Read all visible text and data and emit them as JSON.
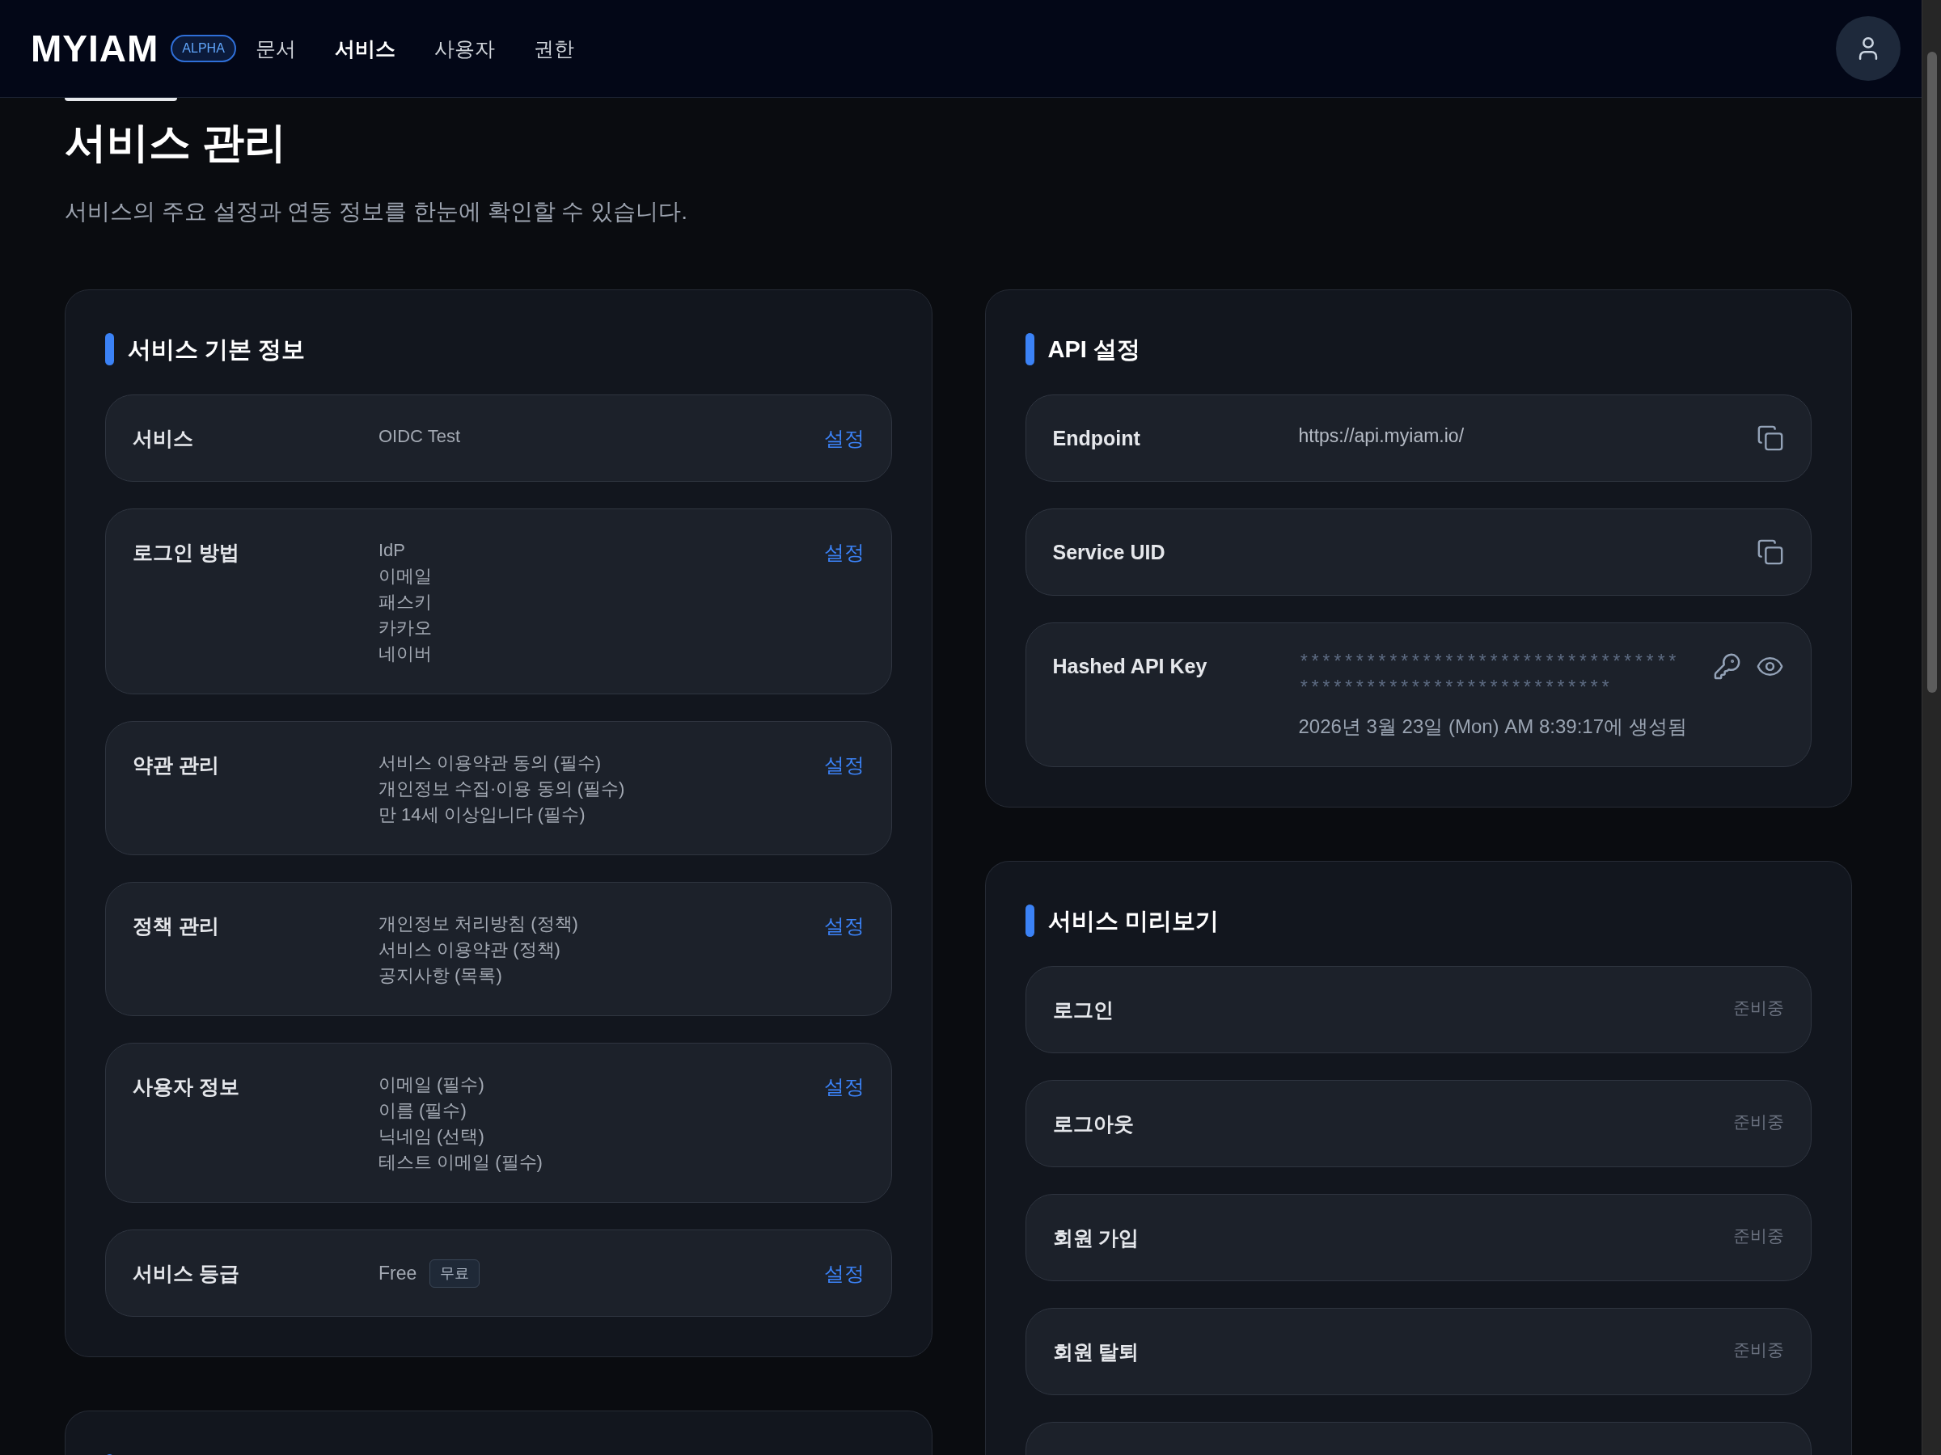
{
  "header": {
    "logo": "MYIAM",
    "badge": "ALPHA",
    "nav": [
      {
        "label": "문서",
        "selected": false
      },
      {
        "label": "서비스",
        "selected": true
      },
      {
        "label": "사용자",
        "selected": false
      },
      {
        "label": "권한",
        "selected": false
      }
    ]
  },
  "page": {
    "title": "서비스 관리",
    "subtitle": "서비스의 주요 설정과 연동 정보를 한눈에 확인할 수 있습니다."
  },
  "basic_info": {
    "title": "서비스 기본 정보",
    "rows": [
      {
        "kind": "lines",
        "label": "서비스",
        "values": [
          "OIDC Test"
        ],
        "action": "설정"
      },
      {
        "kind": "lines",
        "label": "로그인 방법",
        "values": [
          "IdP",
          "이메일",
          "패스키",
          "카카오",
          "네이버"
        ],
        "action": "설정"
      },
      {
        "kind": "lines",
        "label": "약관 관리",
        "values": [
          "서비스 이용약관 동의 (필수)",
          "개인정보 수집·이용 동의 (필수)",
          "만 14세 이상입니다 (필수)"
        ],
        "action": "설정"
      },
      {
        "kind": "lines",
        "label": "정책 관리",
        "values": [
          "개인정보 처리방침 (정책)",
          "서비스 이용약관 (정책)",
          "공지사항 (목록)"
        ],
        "action": "설정"
      },
      {
        "kind": "lines",
        "label": "사용자 정보",
        "values": [
          "이메일 (필수)",
          "이름 (필수)",
          "닉네임 (선택)",
          "테스트 이메일 (필수)"
        ],
        "action": "설정"
      },
      {
        "kind": "tier",
        "label": "서비스 등급",
        "value": "Free",
        "badge": "무료",
        "action": "설정"
      }
    ]
  },
  "api_settings": {
    "title": "API 설정",
    "rows": [
      {
        "kind": "copy",
        "label": "Endpoint",
        "value": "https://api.myiam.io/"
      },
      {
        "kind": "copy",
        "label": "Service UID"
      },
      {
        "kind": "key",
        "label": "Hashed API Key",
        "masked_value": "**************************************************************",
        "created": "2026년 3월 23일 (Mon) AM 8:39:17에 생성됨"
      }
    ]
  },
  "preview": {
    "title": "서비스 미리보기",
    "rows": [
      {
        "label": "로그인",
        "status": "준비중"
      },
      {
        "label": "로그아웃",
        "status": "준비중"
      },
      {
        "label": "회원 가입",
        "status": "준비중"
      },
      {
        "label": "회원 탈퇴",
        "status": "준비중"
      }
    ]
  }
}
